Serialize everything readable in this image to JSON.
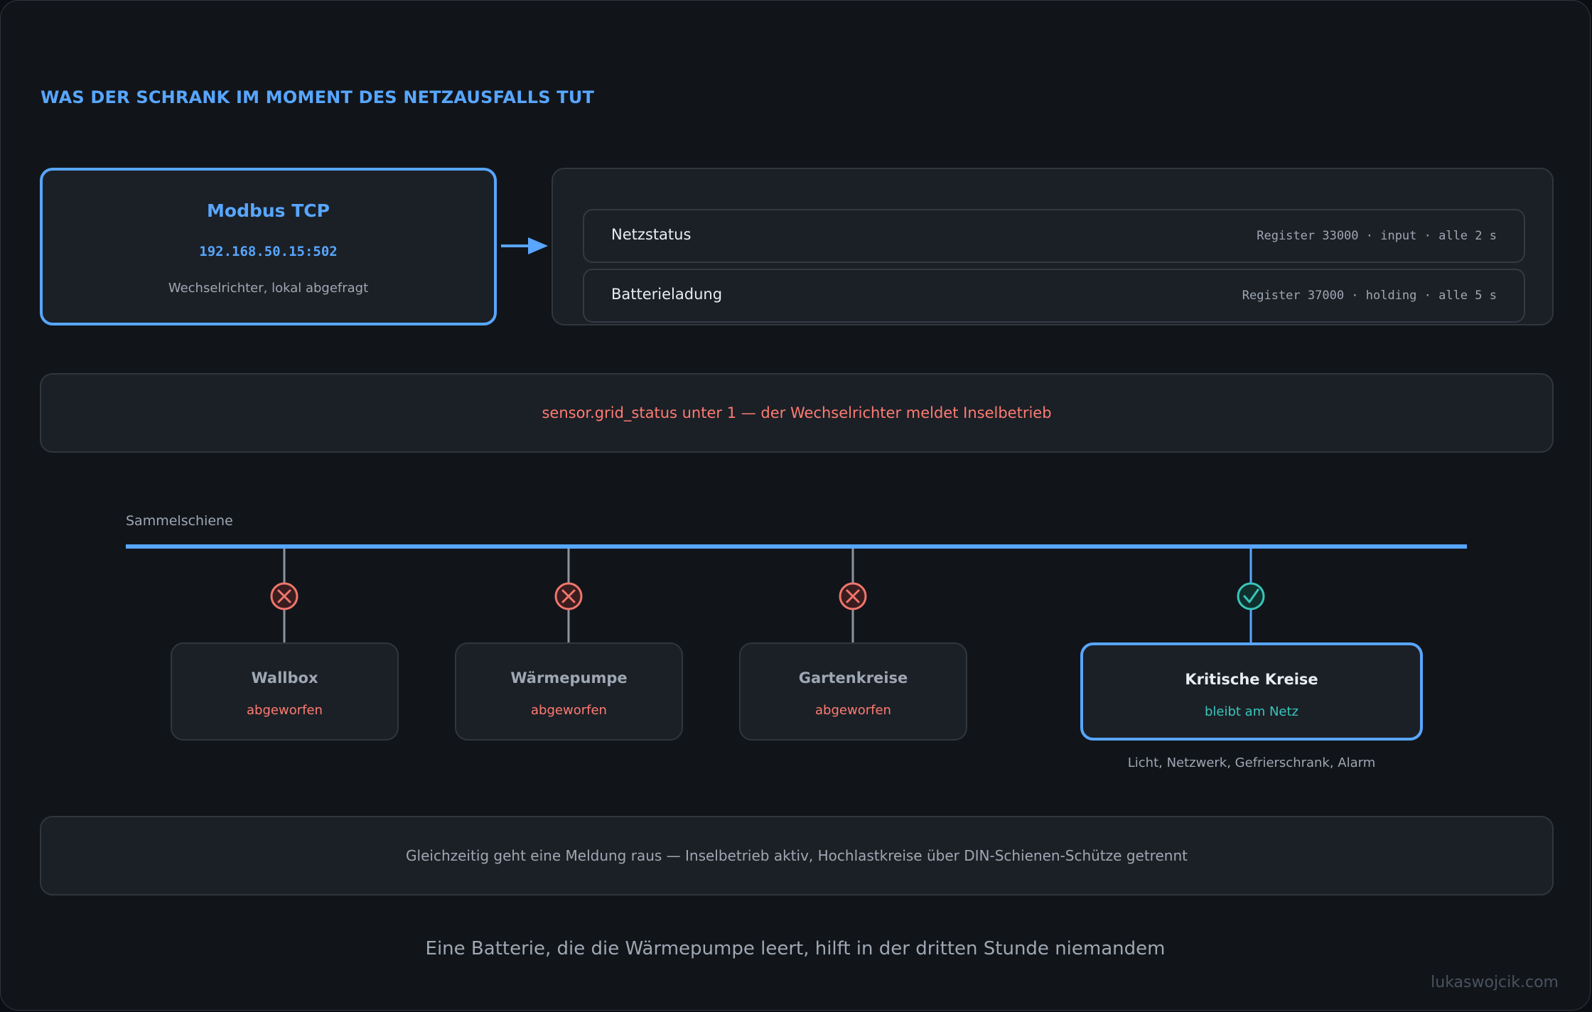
{
  "heading": "WAS DER SCHRANK IM MOMENT DES NETZAUSFALLS TUT",
  "source": {
    "title": "Modbus TCP",
    "address": "192.168.50.15:502",
    "description": "Wechselrichter, lokal abgefragt"
  },
  "registers": [
    {
      "name": "Netzstatus",
      "meta": "Register 33000 · input · alle 2 s"
    },
    {
      "name": "Batterieladung",
      "meta": "Register 37000 · holding · alle 5 s"
    }
  ],
  "trigger": "sensor.grid_status unter 1 — der Wechselrichter meldet Inselbetrieb",
  "busbar_label": "Sammelschiene",
  "loads": [
    {
      "name": "Wallbox",
      "state": "abgeworfen",
      "switch": "open"
    },
    {
      "name": "Wärmepumpe",
      "state": "abgeworfen",
      "switch": "open"
    },
    {
      "name": "Gartenkreise",
      "state": "abgeworfen",
      "switch": "open"
    },
    {
      "name": "Kritische Kreise",
      "state": "bleibt am Netz",
      "switch": "closed"
    }
  ],
  "critical_note": "Licht, Netzwerk, Gefrierschrank, Alarm",
  "notification": "Gleichzeitig geht eine Meldung raus — Inselbetrieb aktiv, Hochlastkreise über DIN-Schienen-Schütze getrennt",
  "footer": "Eine Batterie, die die Wärmepumpe leert, hilft in der dritten Stunde niemandem",
  "credit": "lukaswojcik.com",
  "colors": {
    "accent": "#58a6ff",
    "shed": "#f0766d",
    "kept": "#39c5bb",
    "wire": "#8b949e"
  }
}
